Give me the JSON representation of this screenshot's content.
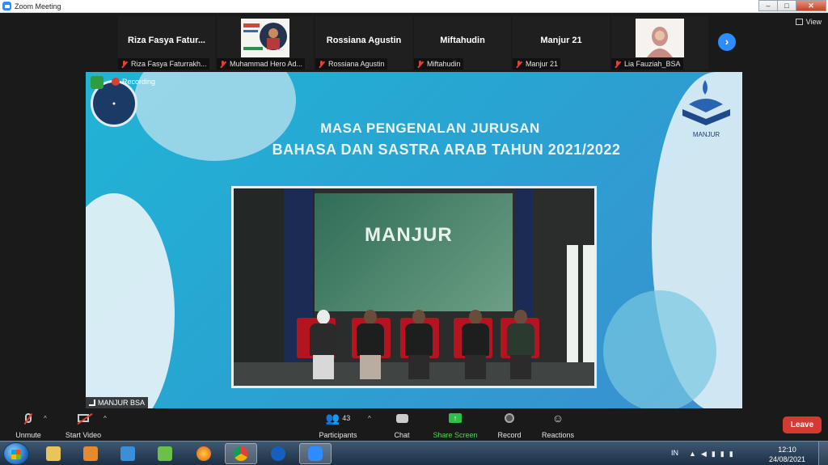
{
  "window": {
    "title": "Zoom Meeting"
  },
  "strip": {
    "view_label": "View",
    "tiles": [
      {
        "display_name": "Riza Fasya Fatur...",
        "label": "Riza Fasya Faturrakh..."
      },
      {
        "display_name": "",
        "label": "Muhammad Hero Ad..."
      },
      {
        "display_name": "Rossiana Agustin",
        "label": "Rossiana Agustin"
      },
      {
        "display_name": "Miftahudin",
        "label": "Miftahudin"
      },
      {
        "display_name": "Manjur 21",
        "label": "Manjur 21"
      },
      {
        "display_name": "",
        "label": "Lia Fauziah_BSA"
      }
    ]
  },
  "share": {
    "recording_label": "Recording",
    "line1": "MASA PENGENALAN JURUSAN",
    "line2": "BAHASA DAN SASTRA ARAB TAHUN 2021/2022",
    "logo_right_text": "MANJUR",
    "stage_text": "MANJUR",
    "presenter_name": "MANJUR BSA"
  },
  "toolbar": {
    "unmute": "Unmute",
    "start_video": "Start Video",
    "participants": "Participants",
    "participant_count": "43",
    "chat": "Chat",
    "share_screen": "Share Screen",
    "record": "Record",
    "reactions": "Reactions",
    "leave": "Leave"
  },
  "taskbar": {
    "language": "IN",
    "time": "12:10",
    "date": "24/08/2021"
  },
  "colors": {
    "zoom_blue": "#2d8cff",
    "leave_red": "#d53a32",
    "share_green": "#52d35a"
  }
}
